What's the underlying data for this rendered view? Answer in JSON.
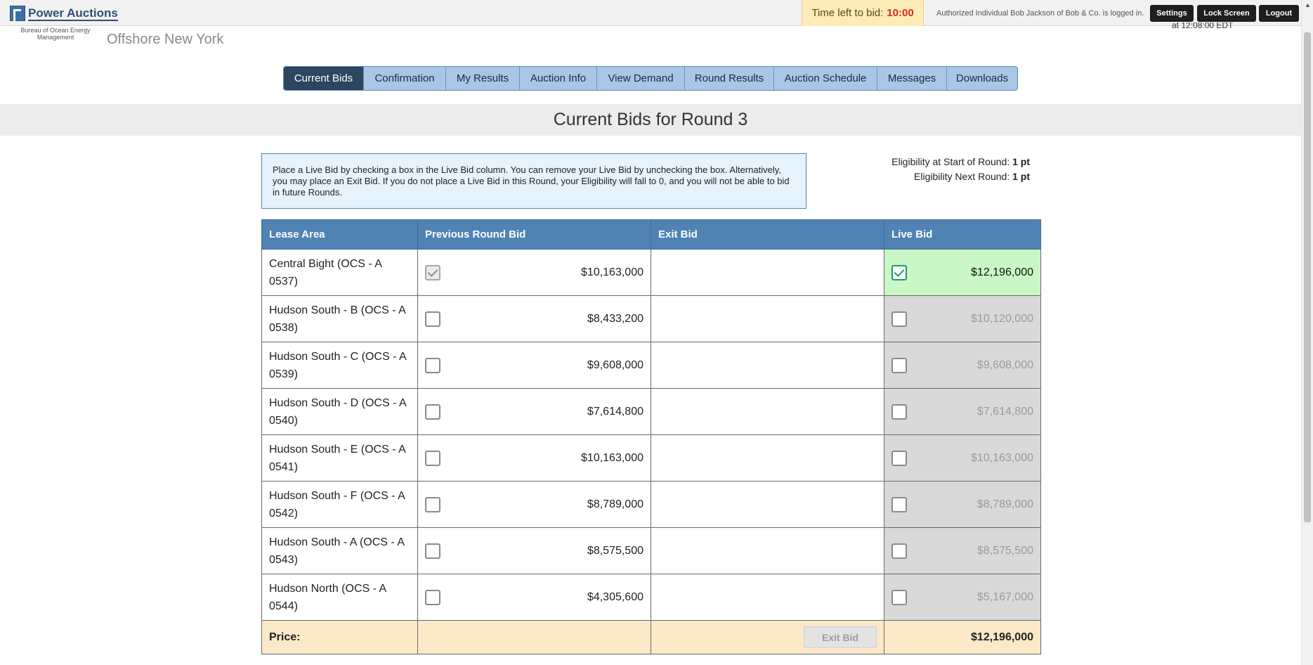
{
  "brand": {
    "name": "Power Auctions",
    "agency": "Bureau of Ocean Energy Management",
    "site_title": "Offshore New York"
  },
  "header": {
    "timer_label": "Time left to bid:",
    "timer_value": "10:00",
    "auth_text": "Authorized Individual Bob Jackson of Bob & Co. is logged in.",
    "settings_label": "Settings",
    "lock_label": "Lock Screen",
    "logout_label": "Logout",
    "timestamp": "at 12:08:00 EDT"
  },
  "tabs": [
    {
      "label": "Current Bids",
      "active": true
    },
    {
      "label": "Confirmation"
    },
    {
      "label": "My Results"
    },
    {
      "label": "Auction Info"
    },
    {
      "label": "View Demand"
    },
    {
      "label": "Round Results"
    },
    {
      "label": "Auction Schedule"
    },
    {
      "label": "Messages"
    },
    {
      "label": "Downloads"
    }
  ],
  "page": {
    "heading": "Current Bids for Round 3",
    "instructions": "Place a Live Bid by checking a box in the Live Bid column. You can remove your Live Bid by unchecking the box. Alternatively, you may place an Exit Bid. If you do not place a Live Bid in this Round, your Eligibility will fall to 0, and you will not be able to bid in future Rounds.",
    "elig_start_label": "Eligibility at Start of Round:",
    "elig_start_value": "1 pt",
    "elig_next_label": "Eligibility Next Round:",
    "elig_next_value": "1 pt"
  },
  "table": {
    "headers": [
      "Lease Area",
      "Previous Round Bid",
      "Exit Bid",
      "Live Bid"
    ],
    "rows": [
      {
        "area": "Central Bight (OCS - A 0537)",
        "prev_bid": "$10,163,000",
        "prev_checked": true,
        "exit_bid": "",
        "live_bid": "$12,196,000",
        "live_checked": true
      },
      {
        "area": "Hudson South - B (OCS - A 0538)",
        "prev_bid": "$8,433,200",
        "prev_checked": false,
        "exit_bid": "",
        "live_bid": "$10,120,000",
        "live_checked": false
      },
      {
        "area": "Hudson South - C (OCS - A 0539)",
        "prev_bid": "$9,608,000",
        "prev_checked": false,
        "exit_bid": "",
        "live_bid": "$9,608,000",
        "live_checked": false
      },
      {
        "area": "Hudson South - D (OCS - A 0540)",
        "prev_bid": "$7,614,800",
        "prev_checked": false,
        "exit_bid": "",
        "live_bid": "$7,614,800",
        "live_checked": false
      },
      {
        "area": "Hudson South - E (OCS - A 0541)",
        "prev_bid": "$10,163,000",
        "prev_checked": false,
        "exit_bid": "",
        "live_bid": "$10,163,000",
        "live_checked": false
      },
      {
        "area": "Hudson South - F (OCS - A 0542)",
        "prev_bid": "$8,789,000",
        "prev_checked": false,
        "exit_bid": "",
        "live_bid": "$8,789,000",
        "live_checked": false
      },
      {
        "area": "Hudson South - A (OCS - A 0543)",
        "prev_bid": "$8,575,500",
        "prev_checked": false,
        "exit_bid": "",
        "live_bid": "$8,575,500",
        "live_checked": false
      },
      {
        "area": "Hudson North (OCS - A 0544)",
        "prev_bid": "$4,305,600",
        "prev_checked": false,
        "exit_bid": "",
        "live_bid": "$5,167,000",
        "live_checked": false
      }
    ],
    "price_label": "Price:",
    "exit_bid_button": "Exit Bid",
    "price_total": "$12,196,000"
  }
}
